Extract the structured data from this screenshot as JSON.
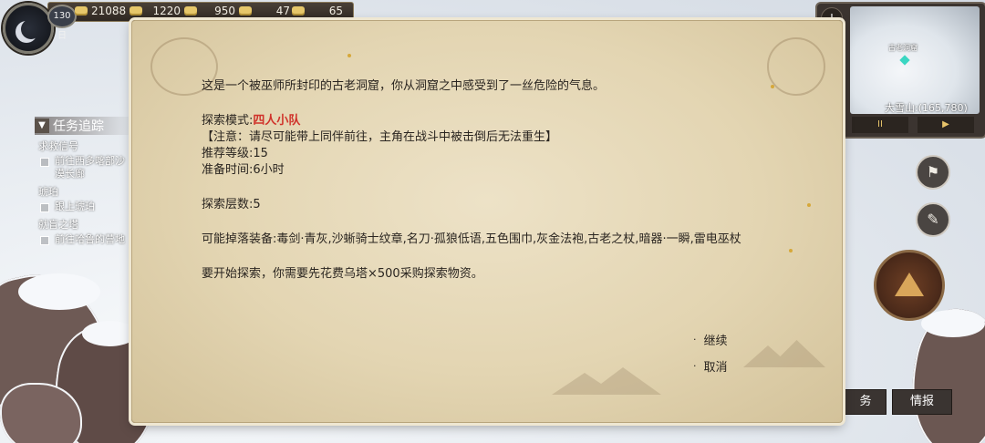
{
  "hud": {
    "day": "130日",
    "resources": [
      {
        "icon": "gold-ingot-icon",
        "value": "21088"
      },
      {
        "icon": "silver-bar-icon",
        "value": "1220"
      },
      {
        "icon": "coin-icon",
        "value": "950"
      },
      {
        "icon": "food-sack-icon",
        "value": "47"
      },
      {
        "icon": "herb-icon",
        "value": "65"
      }
    ]
  },
  "quest_tracker": {
    "title": "任务追踪",
    "groups": [
      {
        "category": "求救信号",
        "items": [
          "前往西多喀部沙漠长廊"
        ]
      },
      {
        "category": "琥珀",
        "items": [
          "跟上琥珀"
        ]
      },
      {
        "category": "就盲之塔",
        "items": [
          "前往哈鲁的营地"
        ]
      }
    ]
  },
  "minimap": {
    "location_label": "古老洞窟",
    "region_coords": "大雪山:(165,780)",
    "pause_label": "II",
    "play_label": "▶",
    "zoom_label": "+"
  },
  "side_buttons": {
    "task_label": "务",
    "intel_label": "情报"
  },
  "dialog": {
    "intro": "这是一个被巫师所封印的古老洞窟，你从洞窟之中感受到了一丝危险的气息。",
    "mode_label": "探索模式:",
    "mode_value": "四人小队",
    "notice": "【注意：请尽可能带上同伴前往，主角在战斗中被击倒后无法重生】",
    "recommended_level": "推荐等级:15",
    "prep_time": "准备时间:6小时",
    "floors": "探索层数:5",
    "drops": "可能掉落装备:毒剑·青灰,沙蜥骑士纹章,名刀·孤狼低语,五色围巾,灰金法袍,古老之杖,暗器·一瞬,雷电巫杖",
    "cost": "要开始探索，你需要先花费乌塔×500采购探索物资。",
    "options": {
      "continue": "继续",
      "cancel": "取消",
      "bullet": "·"
    }
  }
}
